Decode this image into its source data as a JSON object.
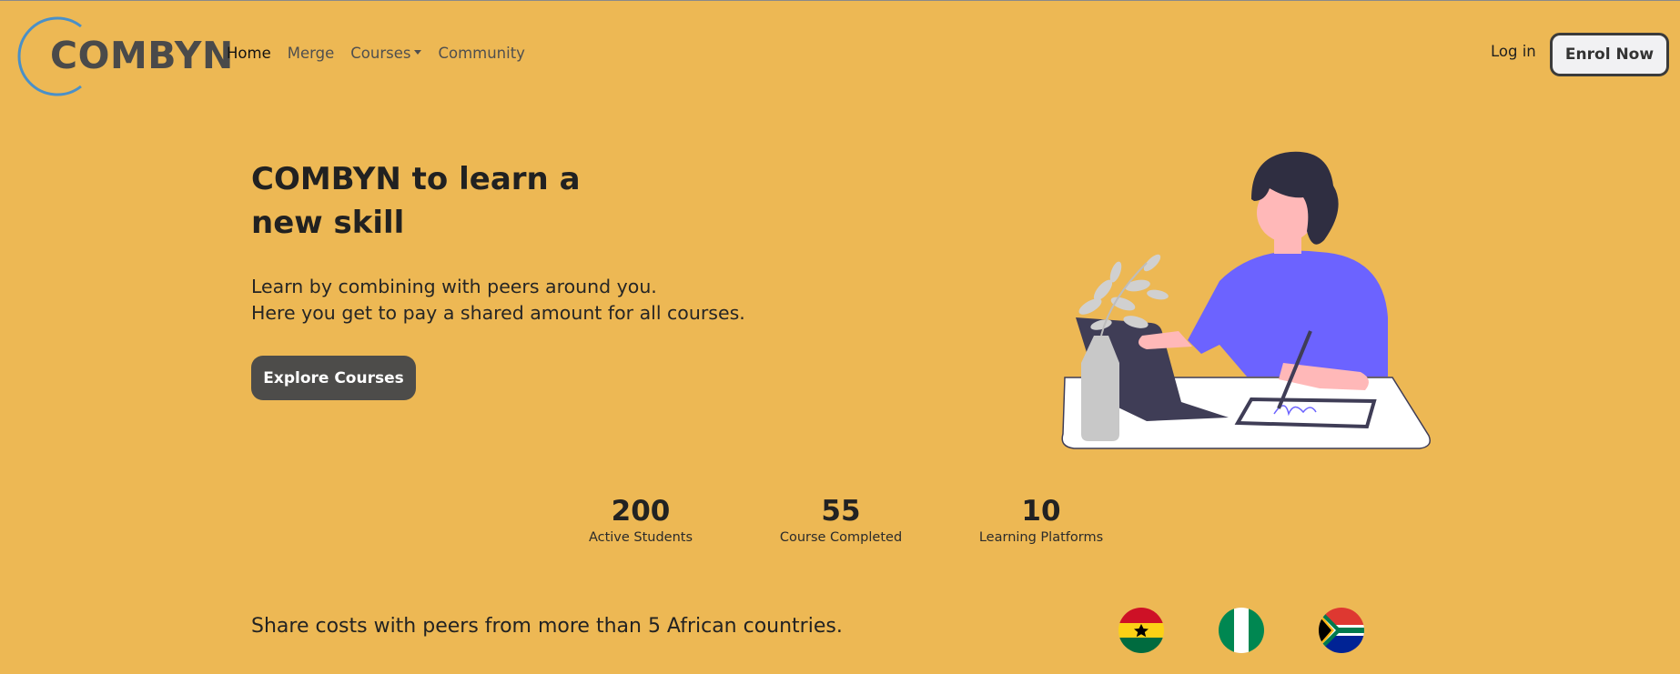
{
  "brand": {
    "name": "COMBYN",
    "ring_color": "#4a90c8"
  },
  "nav": {
    "links": [
      "Home",
      "Merge",
      "Courses",
      "Community"
    ],
    "login": "Log in",
    "enrol": "Enrol Now"
  },
  "hero": {
    "title_line1": "COMBYN to learn a",
    "title_line2": "new skill",
    "subtitle_line1": "Learn by combining with peers around you.",
    "subtitle_line2": "Here you get to pay a shared amount for all courses.",
    "cta": "Explore Courses"
  },
  "stats": [
    {
      "value": "200",
      "label": "Active Students"
    },
    {
      "value": "55",
      "label": "Course Completed"
    },
    {
      "value": "10",
      "label": "Learning Platforms"
    }
  ],
  "share": {
    "text": "Share costs with peers from more than 5 African countries.",
    "flags": [
      "ghana-flag-icon",
      "nigeria-flag-icon",
      "south-africa-flag-icon"
    ]
  },
  "colors": {
    "background": "#edb854",
    "primary_button": "#4d4c4a",
    "illustration_accent": "#6c63ff"
  }
}
